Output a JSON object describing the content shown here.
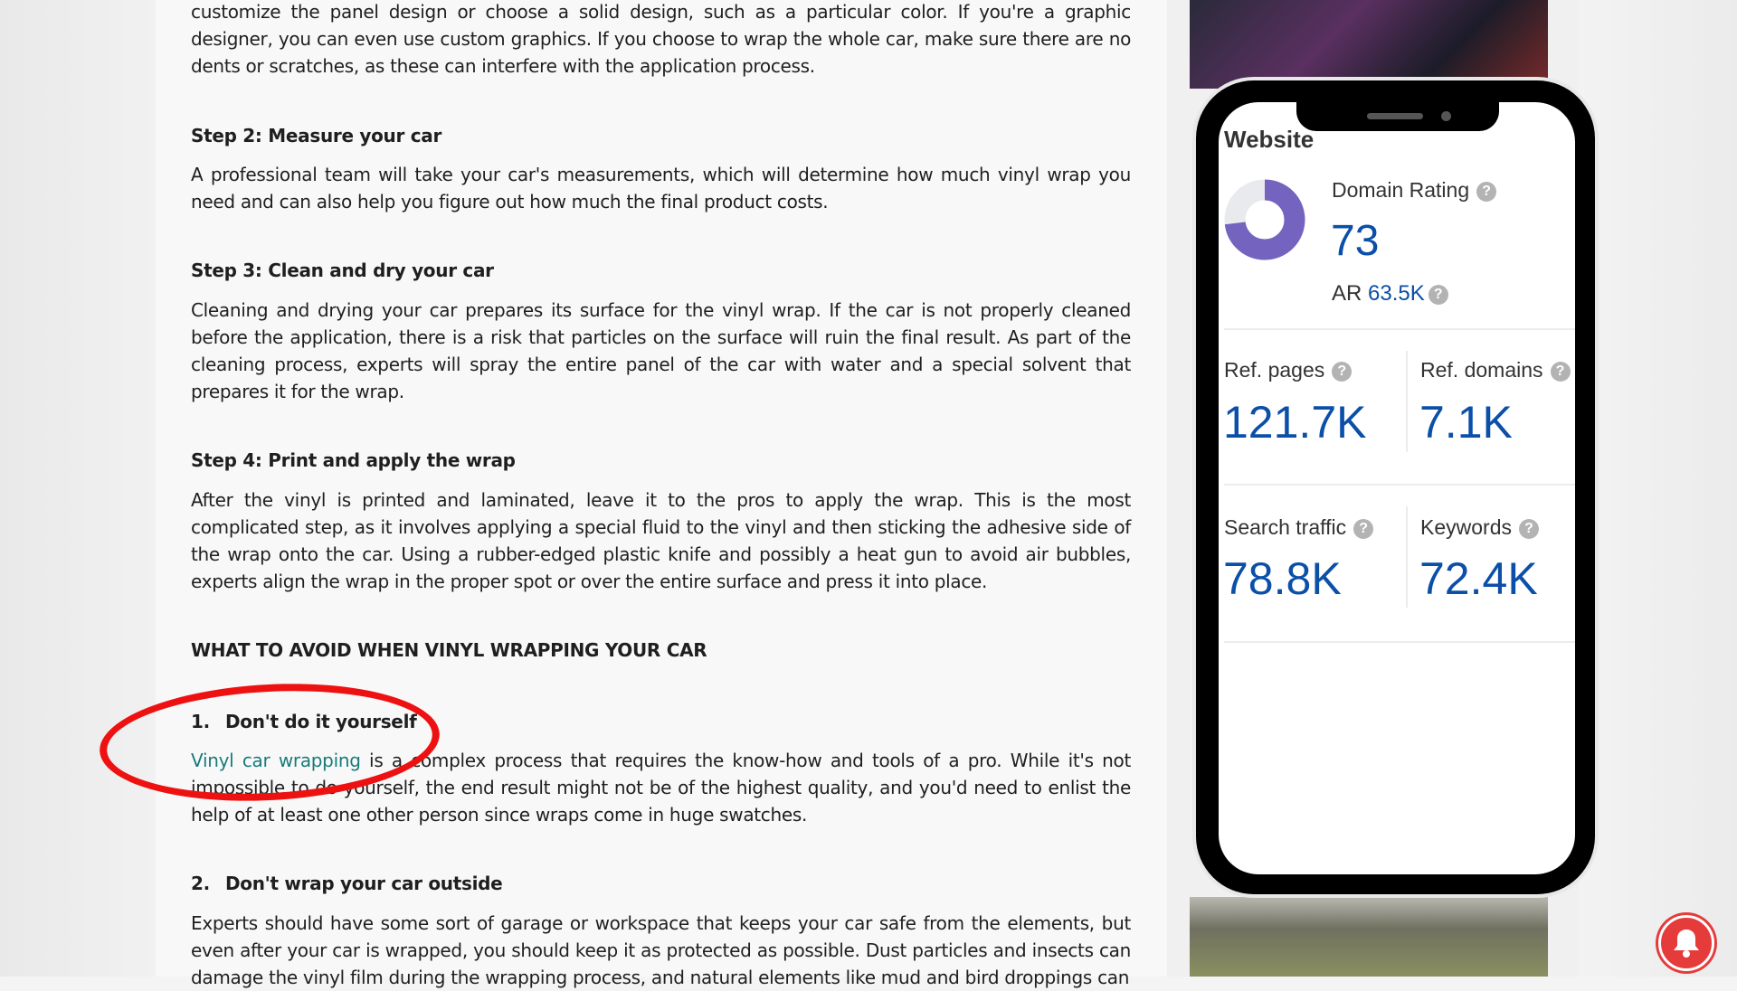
{
  "article": {
    "intro": "customize the panel design or choose a solid design, such as a particular color. If you're a graphic designer, you can even use custom graphics. If you choose to wrap the whole car, make sure there are no dents or scratches, as these can interfere with the application process.",
    "step2_title": "Step 2: Measure your car",
    "step2_text": "A professional team will take your car's measurements, which will determine how much vinyl wrap you need and can also help you figure out how much the final product costs.",
    "step3_title": "Step 3: Clean and dry your car",
    "step3_text": "Cleaning and drying your car prepares its surface for the vinyl wrap. If the car is not properly cleaned before the application, there is a risk that particles on the surface will ruin the final result. As part of the cleaning process, experts will spray the entire panel of the car with water and a special solvent that prepares it for the wrap.",
    "step4_title": "Step 4: Print and apply the wrap",
    "step4_text": "After the vinyl is printed and laminated, leave it to the pros to apply the wrap. This is the most complicated step, as it involves applying a special fluid to the vinyl and then sticking the adhesive side of the wrap onto the car. Using a rubber-edged plastic knife and possibly a heat gun to avoid air bubbles, experts align the wrap in the proper spot or over the entire surface and press it into place.",
    "avoid_title": "WHAT TO AVOID WHEN VINYL WRAPPING YOUR CAR",
    "item1_num": "1.",
    "item1_title": "Don't do it yourself",
    "item1_link": "Vinyl car wrapping",
    "item1_text": " is a complex process that requires the know-how and tools of a pro. While it's not impossible to do yourself, the end result might not be of the highest quality, and you'd need to enlist the help of at least one other person since wraps come in huge swatches.",
    "item2_num": "2.",
    "item2_title": "Don't wrap your car outside",
    "item2_text": "Experts should have some sort of garage or workspace that keeps your car safe from the elements, but even after your car is wrapped, you should keep it as protected as possible. Dust particles and insects can damage the vinyl film during the wrapping process, and natural elements like mud and bird droppings can"
  },
  "widget": {
    "title": "Website",
    "domain_rating_label": "Domain Rating",
    "domain_rating": "73",
    "domain_rating_fraction": 0.73,
    "ar_label": "AR",
    "ar_value": "63.5K",
    "ref_pages_label": "Ref. pages",
    "ref_pages": "121.7K",
    "ref_domains_label": "Ref. domains",
    "ref_domains": "7.1K",
    "search_traffic_label": "Search traffic",
    "search_traffic": "78.8K",
    "keywords_label": "Keywords",
    "keywords": "72.4K",
    "help_glyph": "?",
    "colors": {
      "donut": "#7563c0",
      "value": "#0b4fa8",
      "highlight": "#ee1111",
      "link": "#1b7a7a"
    }
  }
}
